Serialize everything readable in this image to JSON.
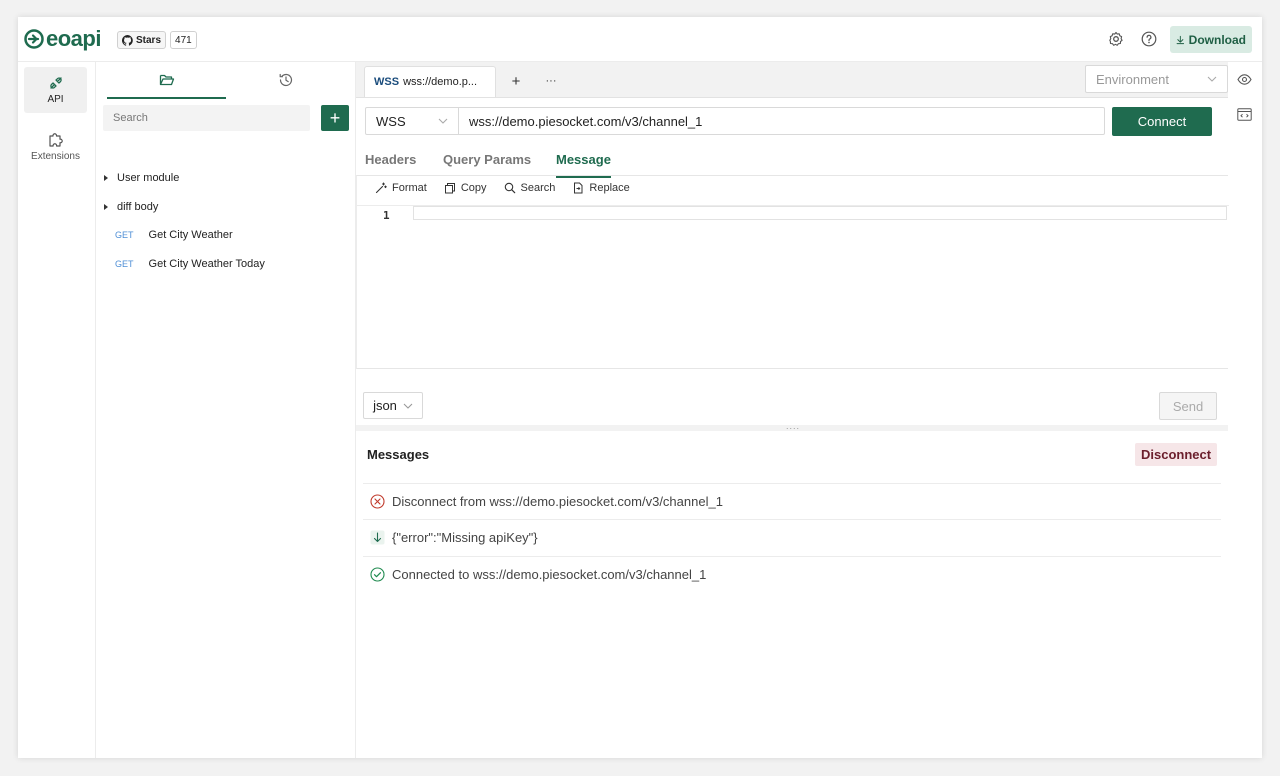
{
  "brand": {
    "name": "eoapi",
    "color": "#1f6b4f"
  },
  "github": {
    "stars_label": "Stars",
    "stars_count": "471"
  },
  "header": {
    "download_label": "Download"
  },
  "rail": {
    "items": [
      {
        "label": "API",
        "icon": "api-icon",
        "active": true
      },
      {
        "label": "Extensions",
        "icon": "puzzle-icon",
        "active": false
      }
    ]
  },
  "sidebar": {
    "tabs": [
      {
        "icon": "folder-icon",
        "active": true
      },
      {
        "icon": "history-icon",
        "active": false
      }
    ],
    "search_placeholder": "Search",
    "add_label": "+",
    "tree": [
      {
        "type": "group",
        "label": "User module"
      },
      {
        "type": "group",
        "label": "diff body"
      },
      {
        "type": "api",
        "method": "GET",
        "label": "Get City Weather"
      },
      {
        "type": "api",
        "method": "GET",
        "label": "Get City Weather Today"
      }
    ]
  },
  "tabs": {
    "active": {
      "protocol": "WSS",
      "title": "wss://demo.p..."
    },
    "add_label": "+",
    "more_label": "···"
  },
  "environment": {
    "placeholder": "Environment"
  },
  "request": {
    "protocol": "WSS",
    "url": "wss://demo.piesocket.com/v3/channel_1",
    "connect_label": "Connect"
  },
  "subtabs": [
    {
      "label": "Headers",
      "active": false
    },
    {
      "label": "Query Params",
      "active": false
    },
    {
      "label": "Message",
      "active": true
    }
  ],
  "editor": {
    "toolbar": [
      {
        "label": "Format",
        "icon": "magic-wand-icon"
      },
      {
        "label": "Copy",
        "icon": "copy-icon"
      },
      {
        "label": "Search",
        "icon": "search-icon"
      },
      {
        "label": "Replace",
        "icon": "replace-icon"
      }
    ],
    "line_number": "1",
    "format": "json",
    "send_label": "Send"
  },
  "messages": {
    "title": "Messages",
    "disconnect_label": "Disconnect",
    "items": [
      {
        "kind": "error",
        "icon": "x-circle-icon",
        "text": "Disconnect from wss://demo.piesocket.com/v3/channel_1",
        "color": "#c0392b"
      },
      {
        "kind": "receive",
        "icon": "arrow-down-icon",
        "text": "{\"error\":\"Missing apiKey\"}",
        "color": "#1f6b4f"
      },
      {
        "kind": "success",
        "icon": "check-circle-icon",
        "text": "Connected to wss://demo.piesocket.com/v3/channel_1",
        "color": "#1f8a4f"
      }
    ]
  }
}
